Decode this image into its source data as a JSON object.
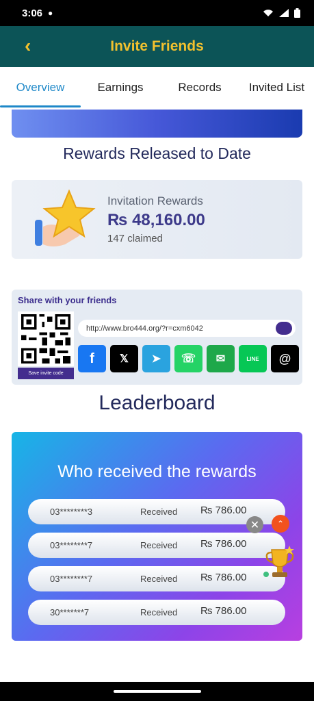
{
  "status_bar": {
    "time": "3:06"
  },
  "header": {
    "back_icon": "chevron-left-icon",
    "title": "Invite Friends"
  },
  "tabs": [
    {
      "label": "Overview",
      "active": true
    },
    {
      "label": "Earnings",
      "active": false
    },
    {
      "label": "Records",
      "active": false
    },
    {
      "label": "Invited List",
      "active": false
    }
  ],
  "rewards": {
    "heading": "Rewards Released to Date",
    "label": "Invitation Rewards",
    "amount": "₨ 48,160.00",
    "claimed": "147 claimed"
  },
  "share": {
    "title": "Share with your friends",
    "save_label": "Save invite code",
    "url": "http://www.bro444.org/?r=cxm6042",
    "platforms": [
      {
        "name": "facebook-icon",
        "label": "f",
        "color": "#1877f2"
      },
      {
        "name": "x-icon",
        "label": "𝕏",
        "color": "#000000"
      },
      {
        "name": "telegram-icon",
        "label": "➤",
        "color": "#2aa3df"
      },
      {
        "name": "whatsapp-icon",
        "label": "☏",
        "color": "#25d366"
      },
      {
        "name": "sms-icon",
        "label": "✉",
        "color": "#1ea84a"
      },
      {
        "name": "line-icon",
        "label": "LINE",
        "color": "#06c755"
      },
      {
        "name": "threads-icon",
        "label": "@",
        "color": "#000000"
      }
    ]
  },
  "leaderboard": {
    "heading": "Leaderboard",
    "card_title": "Who received the rewards",
    "rows": [
      {
        "phone": "03********3",
        "status": "Received",
        "amount": "₨ 786.00"
      },
      {
        "phone": "03********7",
        "status": "Received",
        "amount": "₨ 786.00"
      },
      {
        "phone": "03********7",
        "status": "Received",
        "amount": "₨ 786.00"
      },
      {
        "phone": "30*******7",
        "status": "Received",
        "amount": "₨ 786.00"
      }
    ]
  },
  "colors": {
    "header_bg": "#0c5457",
    "accent_gold": "#f2c12e",
    "tab_active": "#1e88c8",
    "brand_purple": "#432d8e"
  }
}
